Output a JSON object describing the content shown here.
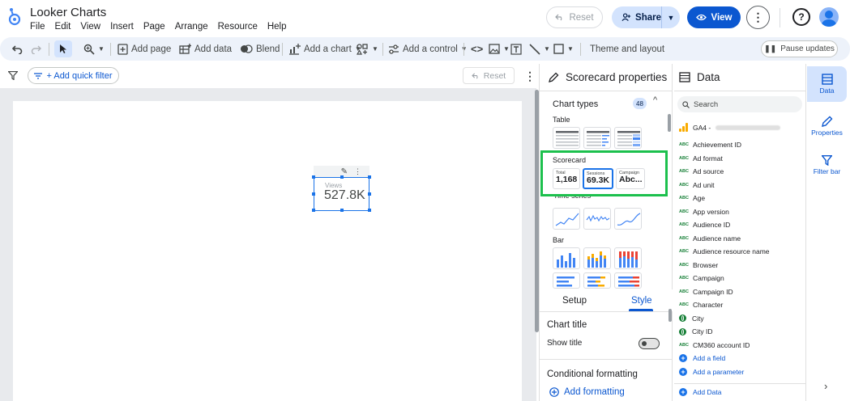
{
  "app": {
    "title": "Looker Charts"
  },
  "menu": [
    "File",
    "Edit",
    "View",
    "Insert",
    "Page",
    "Arrange",
    "Resource",
    "Help"
  ],
  "header": {
    "reset_label": "Reset",
    "share_label": "Share",
    "view_label": "View"
  },
  "toolbar": {
    "add_page": "Add page",
    "add_data": "Add data",
    "blend": "Blend",
    "add_chart": "Add a chart",
    "add_control": "Add a control",
    "theme": "Theme and layout",
    "pause": "Pause updates"
  },
  "filterbar": {
    "quick_filter": "+ Add quick filter",
    "reset": "Reset"
  },
  "scorecard": {
    "label": "Views",
    "value": "527.8K"
  },
  "properties": {
    "title": "Scorecard properties",
    "chart_types_label": "Chart types",
    "chart_types_count": "48",
    "section_table": "Table",
    "section_scorecard": "Scorecard",
    "section_timeseries": "Time series",
    "section_bar": "Bar",
    "sc_options": [
      {
        "label": "Total",
        "value": "1,168"
      },
      {
        "label": "Sessions",
        "value": "69.3K"
      },
      {
        "label": "Campaign",
        "value": "Abc..."
      }
    ],
    "tab_setup": "Setup",
    "tab_style": "Style",
    "chart_title_heading": "Chart title",
    "show_title_label": "Show title",
    "conditional_formatting": "Conditional formatting",
    "add_formatting": "Add formatting"
  },
  "data_panel": {
    "title": "Data",
    "search_placeholder": "Search",
    "source_prefix": "GA4 -",
    "fields": [
      {
        "type": "abc",
        "name": "Achievement ID"
      },
      {
        "type": "abc",
        "name": "Ad format"
      },
      {
        "type": "abc",
        "name": "Ad source"
      },
      {
        "type": "abc",
        "name": "Ad unit"
      },
      {
        "type": "abc",
        "name": "Age"
      },
      {
        "type": "abc",
        "name": "App version"
      },
      {
        "type": "abc",
        "name": "Audience ID"
      },
      {
        "type": "abc",
        "name": "Audience name"
      },
      {
        "type": "abc",
        "name": "Audience resource name"
      },
      {
        "type": "abc",
        "name": "Browser"
      },
      {
        "type": "abc",
        "name": "Campaign"
      },
      {
        "type": "abc",
        "name": "Campaign ID"
      },
      {
        "type": "abc",
        "name": "Character"
      },
      {
        "type": "geo",
        "name": "City"
      },
      {
        "type": "geo",
        "name": "City ID"
      },
      {
        "type": "abc",
        "name": "CM360 account ID"
      }
    ],
    "add_field": "Add a field",
    "add_parameter": "Add a parameter",
    "add_data": "Add Data"
  },
  "rail": {
    "data": "Data",
    "properties": "Properties",
    "filter_bar": "Filter bar"
  },
  "colors": {
    "accent": "#0b57d0",
    "highlight": "#1cc04d",
    "abc_green": "#188038"
  }
}
